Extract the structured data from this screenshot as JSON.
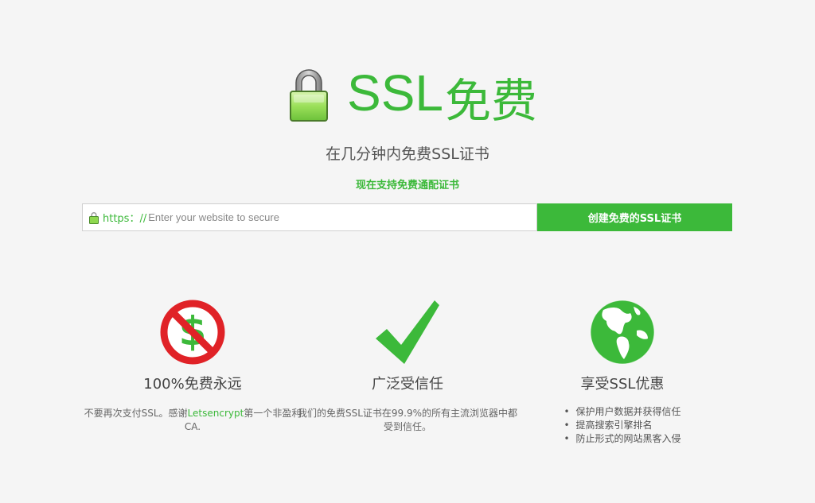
{
  "hero": {
    "title_ssl": "SSL",
    "title_free": "免费",
    "subtitle": "在几分钟内免费SSL证书",
    "wildcard_note": "现在支持免费通配证书"
  },
  "form": {
    "https_prefix": "https：//",
    "placeholder": "Enter your website to secure",
    "submit_label": "创建免费的SSL证书"
  },
  "features": [
    {
      "icon": "no-dollar-icon",
      "title": "100%免费永远",
      "desc_before": "不要再次支付SSL。感谢",
      "desc_link": "Letsencrypt",
      "desc_after": "第一个非盈利CA."
    },
    {
      "icon": "checkmark-icon",
      "title": "广泛受信任",
      "desc": "我们的免费SSL证书在99.9%的所有主流浏览器中都受到信任。"
    },
    {
      "icon": "globe-icon",
      "title": "享受SSL优惠",
      "items": [
        "保护用户数据并获得信任",
        "提高搜索引擎排名",
        "防止形式的网站黑客入侵"
      ]
    }
  ],
  "colors": {
    "accent": "#3cb93a",
    "background": "#f5f5f5",
    "no_sign_red": "#e02227"
  }
}
